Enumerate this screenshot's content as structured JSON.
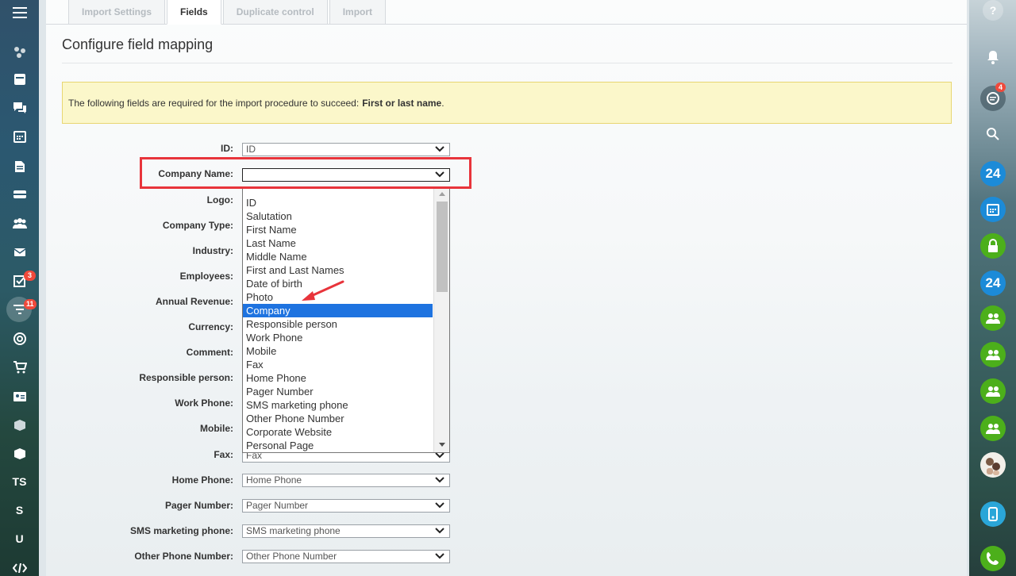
{
  "tabs": [
    {
      "label": "Import Settings",
      "active": false
    },
    {
      "label": "Fields",
      "active": true
    },
    {
      "label": "Duplicate control",
      "active": false
    },
    {
      "label": "Import",
      "active": false
    }
  ],
  "page_title": "Configure field mapping",
  "notice": {
    "text": "The following fields are required for the import procedure to succeed:",
    "bold": "First or last name",
    "end": "."
  },
  "fields": [
    {
      "label": "ID:",
      "value": "ID"
    },
    {
      "label": "Company Name:",
      "value": ""
    },
    {
      "label": "Logo:",
      "value": ""
    },
    {
      "label": "Company Type:",
      "value": ""
    },
    {
      "label": "Industry:",
      "value": ""
    },
    {
      "label": "Employees:",
      "value": ""
    },
    {
      "label": "Annual Revenue:",
      "value": ""
    },
    {
      "label": "Currency:",
      "value": ""
    },
    {
      "label": "Comment:",
      "value": ""
    },
    {
      "label": "Responsible person:",
      "value": ""
    },
    {
      "label": "Work Phone:",
      "value": ""
    },
    {
      "label": "Mobile:",
      "value": ""
    },
    {
      "label": "Fax:",
      "value": "Fax"
    },
    {
      "label": "Home Phone:",
      "value": "Home Phone"
    },
    {
      "label": "Pager Number:",
      "value": "Pager Number"
    },
    {
      "label": "SMS marketing phone:",
      "value": "SMS marketing phone"
    },
    {
      "label": "Other Phone Number:",
      "value": "Other Phone Number"
    }
  ],
  "dropdown": {
    "options": [
      "ID",
      "Salutation",
      "First Name",
      "Last Name",
      "Middle Name",
      "First and Last Names",
      "Date of birth",
      "Photo",
      "Company",
      "Responsible person",
      "Work Phone",
      "Mobile",
      "Fax",
      "Home Phone",
      "Pager Number",
      "SMS marketing phone",
      "Other Phone Number",
      "Corporate Website",
      "Personal Page"
    ],
    "selected": "Company"
  },
  "left_sidebar": {
    "text_items": [
      "TS",
      "S",
      "U"
    ],
    "badges": {
      "tasks": "3",
      "filter": "11"
    }
  },
  "right_sidebar": {
    "badge_chat": "4",
    "label_24": "24"
  },
  "colors": {
    "highlight": "#e8343b",
    "selected_option": "#1e73e0",
    "notice_bg": "#fbf7ca",
    "green": "#4caf1b",
    "blue": "#1c8bd8"
  }
}
